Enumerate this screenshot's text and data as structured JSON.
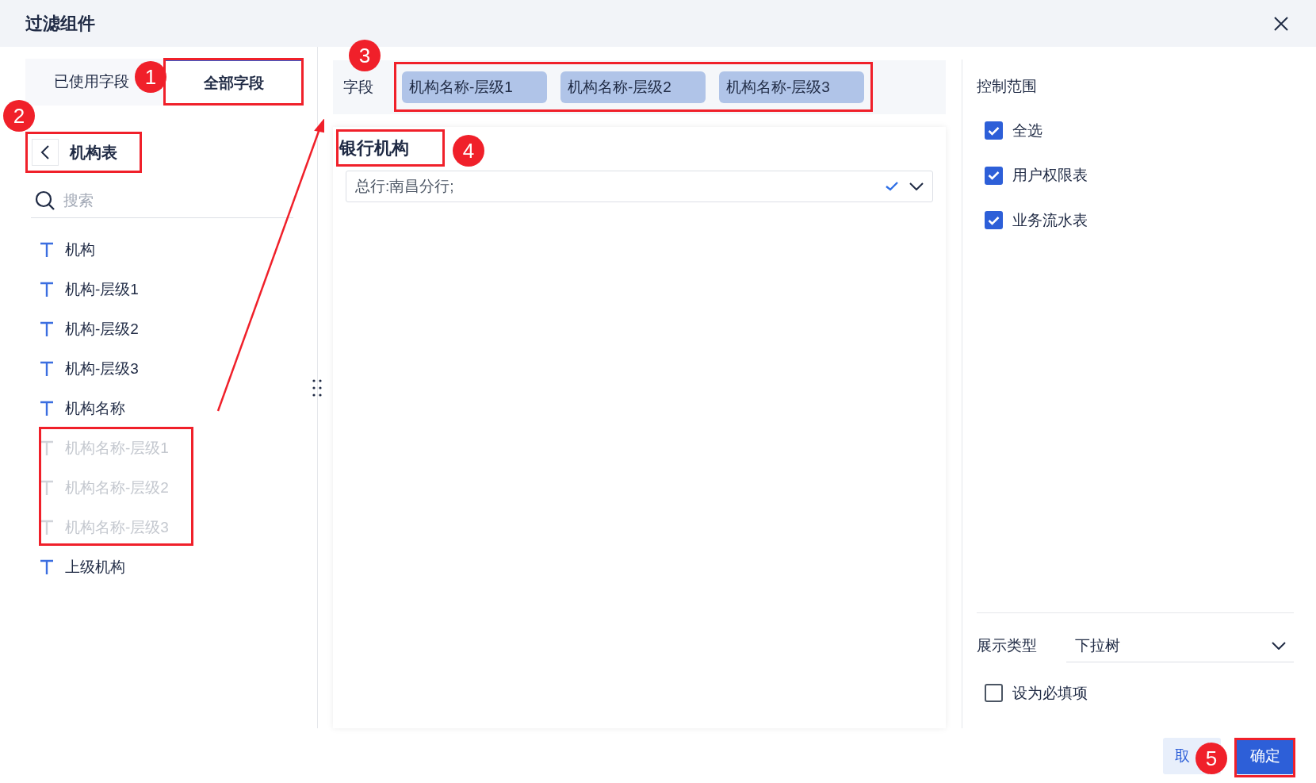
{
  "dialog": {
    "title": "过滤组件"
  },
  "field_tabs": [
    {
      "label": "已使用字段",
      "selected": false
    },
    {
      "label": "全部字段",
      "selected": true
    }
  ],
  "table": {
    "name": "机构表"
  },
  "search": {
    "placeholder": "搜索"
  },
  "fields": [
    {
      "label": "机构",
      "disabled": false
    },
    {
      "label": "机构-层级1",
      "disabled": false
    },
    {
      "label": "机构-层级2",
      "disabled": false
    },
    {
      "label": "机构-层级3",
      "disabled": false
    },
    {
      "label": "机构名称",
      "disabled": false
    },
    {
      "label": "机构名称-层级1",
      "disabled": true
    },
    {
      "label": "机构名称-层级2",
      "disabled": true
    },
    {
      "label": "机构名称-层级3",
      "disabled": true
    },
    {
      "label": "上级机构",
      "disabled": false
    }
  ],
  "field_bar": {
    "label": "字段",
    "chips": [
      "机构名称-层级1",
      "机构名称-层级2",
      "机构名称-层级3"
    ]
  },
  "filter": {
    "title": "银行机构",
    "value": "总行:南昌分行;"
  },
  "control_scope": {
    "title": "控制范围",
    "options": [
      {
        "label": "全选",
        "checked": true
      },
      {
        "label": "用户权限表",
        "checked": true
      },
      {
        "label": "业务流水表",
        "checked": true
      }
    ]
  },
  "display_type": {
    "label": "展示类型",
    "value": "下拉树"
  },
  "required": {
    "label": "设为必填项",
    "checked": false
  },
  "buttons": {
    "cancel": "取",
    "confirm": "确定"
  },
  "annotations": [
    "1",
    "2",
    "3",
    "4",
    "5"
  ]
}
